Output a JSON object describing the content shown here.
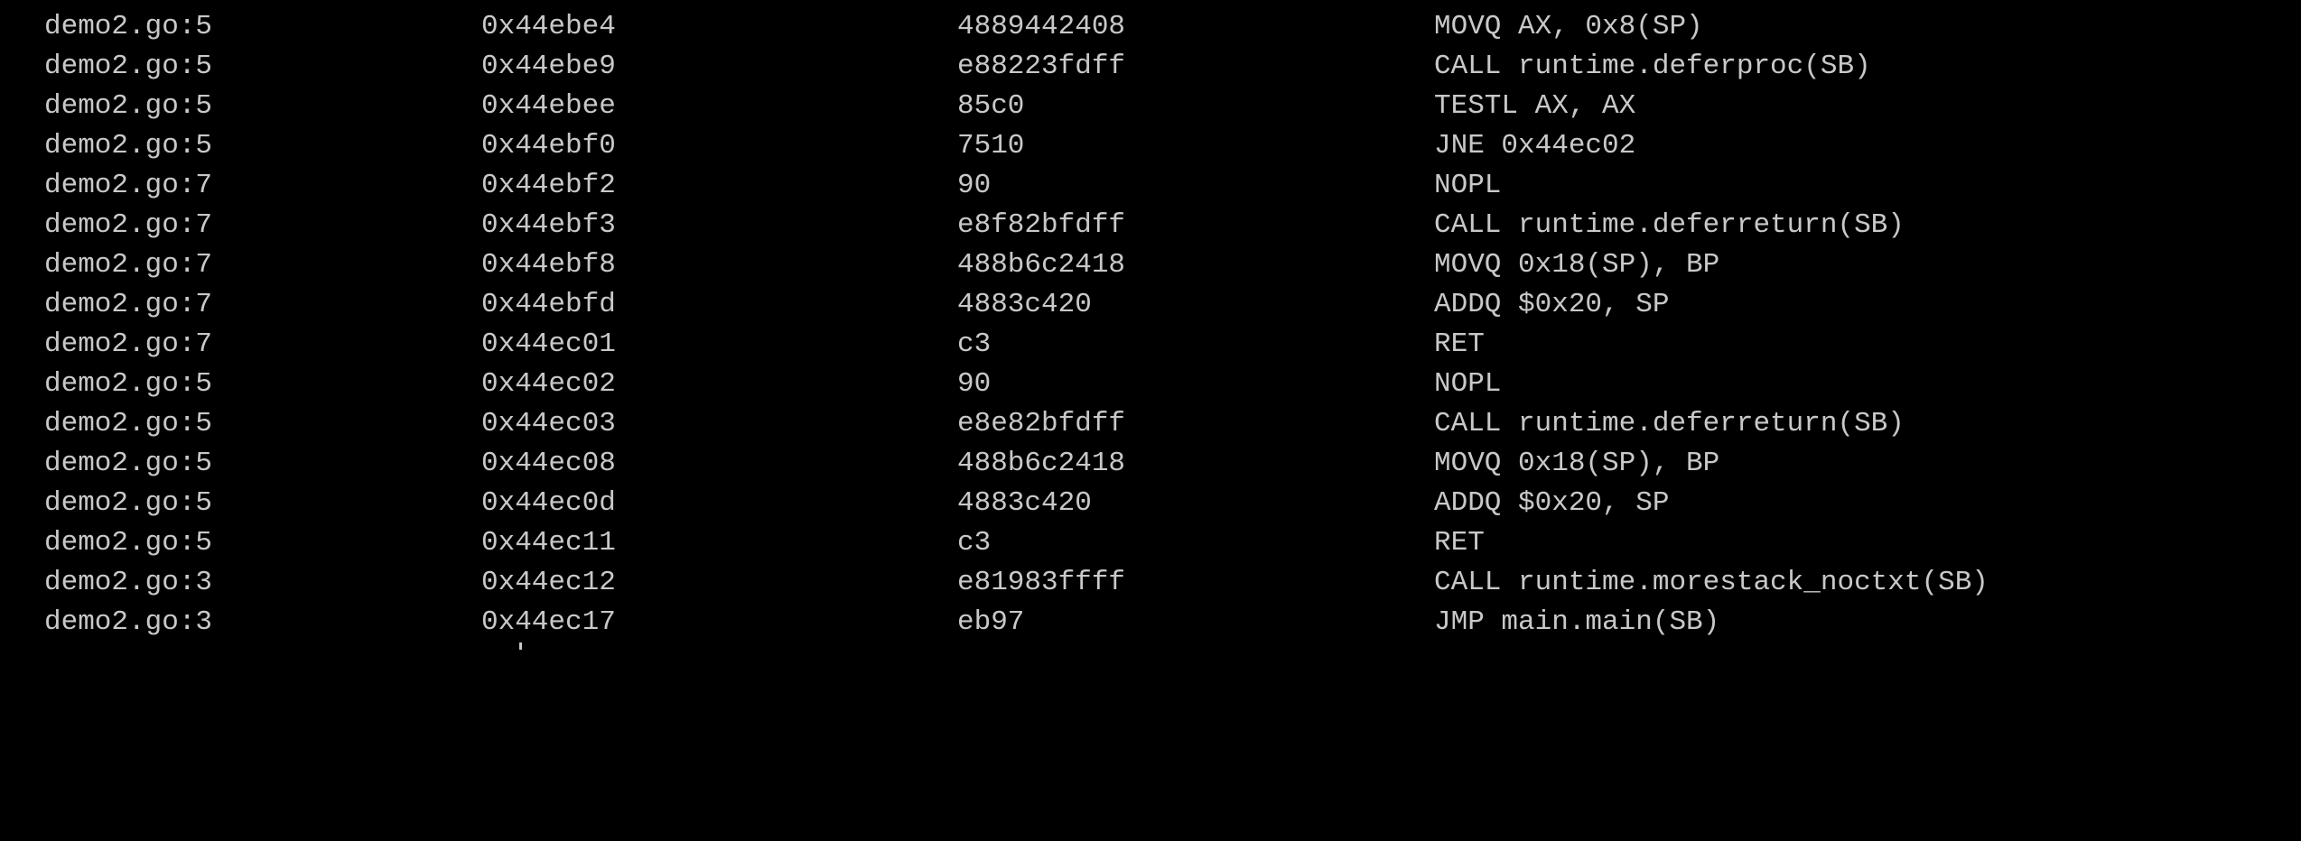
{
  "terminal": {
    "rows": [
      {
        "file": "demo2.go:5",
        "addr": "0x44ebe4",
        "hex": "4889442408",
        "asm": "MOVQ AX, 0x8(SP)"
      },
      {
        "file": "demo2.go:5",
        "addr": "0x44ebe9",
        "hex": "e88223fdff",
        "asm": "CALL runtime.deferproc(SB)"
      },
      {
        "file": "demo2.go:5",
        "addr": "0x44ebee",
        "hex": "85c0",
        "asm": "TESTL AX, AX"
      },
      {
        "file": "demo2.go:5",
        "addr": "0x44ebf0",
        "hex": "7510",
        "asm": "JNE 0x44ec02"
      },
      {
        "file": "demo2.go:7",
        "addr": "0x44ebf2",
        "hex": "90",
        "asm": "NOPL"
      },
      {
        "file": "demo2.go:7",
        "addr": "0x44ebf3",
        "hex": "e8f82bfdff",
        "asm": "CALL runtime.deferreturn(SB)"
      },
      {
        "file": "demo2.go:7",
        "addr": "0x44ebf8",
        "hex": "488b6c2418",
        "asm": "MOVQ 0x18(SP), BP"
      },
      {
        "file": "demo2.go:7",
        "addr": "0x44ebfd",
        "hex": "4883c420",
        "asm": "ADDQ $0x20, SP"
      },
      {
        "file": "demo2.go:7",
        "addr": "0x44ec01",
        "hex": "c3",
        "asm": "RET"
      },
      {
        "file": "demo2.go:5",
        "addr": "0x44ec02",
        "hex": "90",
        "asm": "NOPL"
      },
      {
        "file": "demo2.go:5",
        "addr": "0x44ec03",
        "hex": "e8e82bfdff",
        "asm": "CALL runtime.deferreturn(SB)"
      },
      {
        "file": "demo2.go:5",
        "addr": "0x44ec08",
        "hex": "488b6c2418",
        "asm": "MOVQ 0x18(SP), BP"
      },
      {
        "file": "demo2.go:5",
        "addr": "0x44ec0d",
        "hex": "4883c420",
        "asm": "ADDQ $0x20, SP"
      },
      {
        "file": "demo2.go:5",
        "addr": "0x44ec11",
        "hex": "c3",
        "asm": "RET"
      },
      {
        "file": "demo2.go:3",
        "addr": "0x44ec12",
        "hex": "e81983ffff",
        "asm": "CALL runtime.morestack_noctxt(SB)"
      },
      {
        "file": "demo2.go:3",
        "addr": "0x44ec17",
        "hex": "eb97",
        "asm": "JMP main.main(SB)"
      }
    ]
  },
  "colors": {
    "background": "#000000",
    "text": "#c8c8c8"
  }
}
